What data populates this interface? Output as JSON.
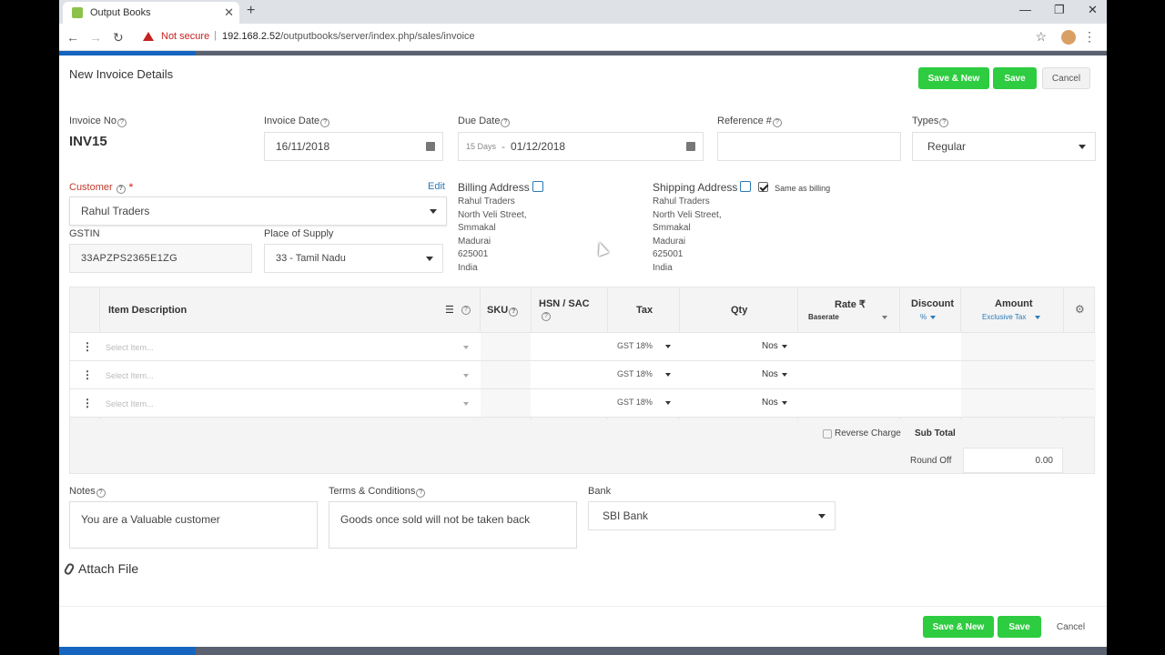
{
  "browser": {
    "tab_title": "Output Books",
    "security": "Not secure",
    "url_host": "192.168.2.52",
    "url_path": "/outputbooks/server/index.php/sales/invoice"
  },
  "header": {
    "title": "New Invoice Details",
    "save_new": "Save & New",
    "save": "Save",
    "cancel": "Cancel"
  },
  "form": {
    "invoice_no_label": "Invoice No",
    "invoice_no": "INV15",
    "invoice_date_label": "Invoice Date",
    "invoice_date": "16/11/2018",
    "due_date_label": "Due Date",
    "due_terms": "15 Days",
    "due_sep": "-",
    "due_date": "01/12/2018",
    "reference_label": "Reference #",
    "reference_value": "",
    "types_label": "Types",
    "types_value": "Regular",
    "customer_label": "Customer",
    "required_mark": "*",
    "edit_link": "Edit",
    "customer_value": "Rahul Traders",
    "gstin_label": "GSTIN",
    "gstin_value": "33APZPS2365E1ZG",
    "pos_label": "Place of Supply",
    "pos_value": "33 - Tamil Nadu"
  },
  "billing": {
    "title": "Billing Address",
    "lines": [
      "Rahul Traders",
      "North Veli Street,",
      "Smmakal",
      "Madurai",
      "625001",
      "India"
    ]
  },
  "shipping": {
    "title": "Shipping Address",
    "same_label": "Same as billing",
    "same_checked": true,
    "lines": [
      "Rahul Traders",
      "North Veli Street,",
      "Smmakal",
      "Madurai",
      "625001",
      "India"
    ]
  },
  "table": {
    "col_item": "Item Description",
    "col_sku": "SKU",
    "col_hsn": "HSN / SAC",
    "col_tax": "Tax",
    "col_qty": "Qty",
    "col_rate": "Rate ₹",
    "rate_sub": "Baserate",
    "col_discount": "Discount",
    "discount_sub": "%",
    "col_amount": "Amount",
    "amount_sub": "Exclusive Tax",
    "rows": [
      {
        "item": "Select Item...",
        "tax": "GST 18%",
        "unit": "Nos"
      },
      {
        "item": "Select Item...",
        "tax": "GST 18%",
        "unit": "Nos"
      },
      {
        "item": "Select Item...",
        "tax": "GST 18%",
        "unit": "Nos"
      }
    ],
    "reverse_charge": "Reverse Charge",
    "sub_total": "Sub Total",
    "round_off": "Round Off",
    "round_off_value": "0.00"
  },
  "bottom": {
    "notes_label": "Notes",
    "notes_value": "You are a Valuable customer",
    "terms_label": "Terms & Conditions",
    "terms_value": "Goods once sold will not be taken back",
    "bank_label": "Bank",
    "bank_value": "SBI Bank",
    "attach": "Attach File"
  },
  "footer": {
    "save_new": "Save & New",
    "save": "Save",
    "cancel": "Cancel"
  }
}
